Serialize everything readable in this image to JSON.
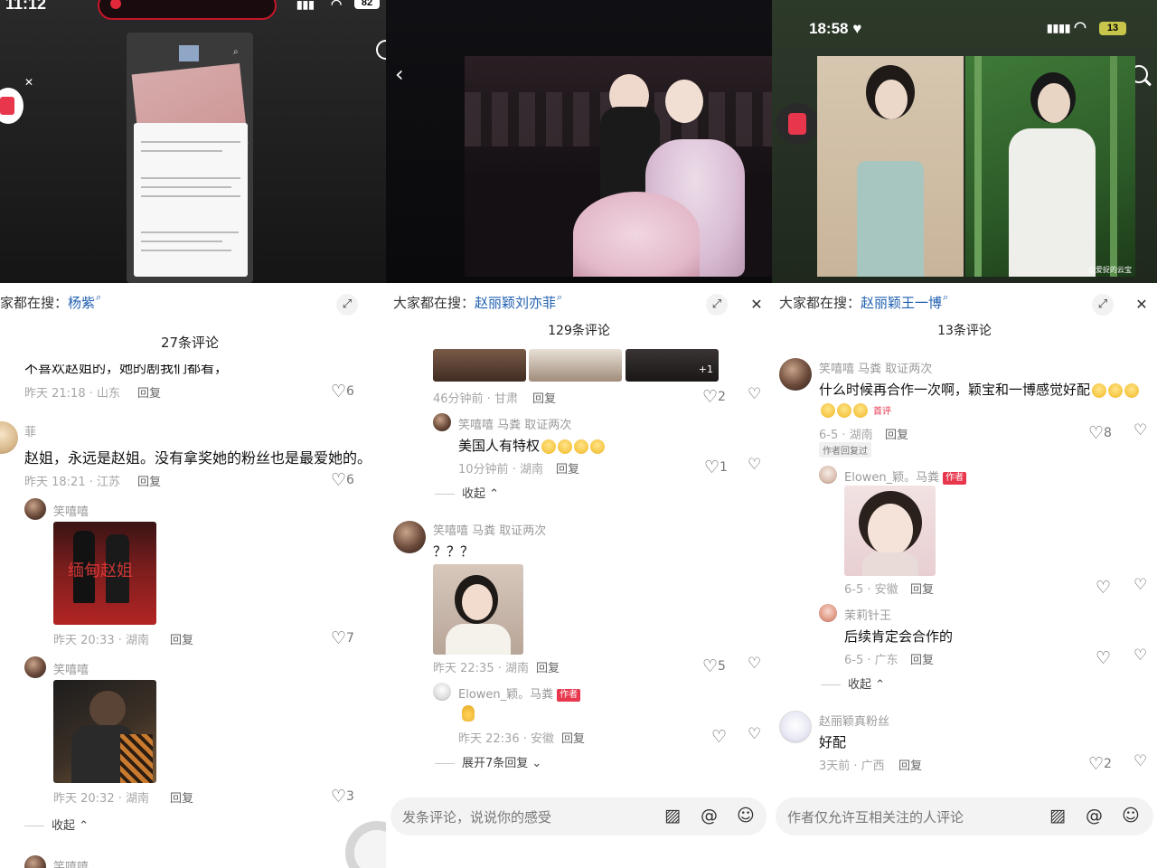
{
  "panel1": {
    "status_time": "11:12",
    "battery": "82",
    "search_prefix": "家都在搜：",
    "search_keyword": "杨紫",
    "comment_count": "27条评论",
    "comments": [
      {
        "text": "不喜欢赵姐的，她的剧我们都看，",
        "meta": "昨天 21:18 · 山东",
        "reply": "回复",
        "likes": "6"
      },
      {
        "user": "菲",
        "text": "赵姐，永远是赵姐。没有拿奖她的粉丝也是最爱她的。",
        "meta": "昨天 18:21 · 江苏",
        "reply": "回复",
        "likes": "6"
      },
      {
        "user": "笑嘻嘻",
        "image_caption": "缅甸赵姐",
        "meta": "昨天 20:33 · 湖南",
        "reply": "回复",
        "likes": "7"
      },
      {
        "user": "笑嘻嘻",
        "meta": "昨天 20:32 · 湖南",
        "reply": "回复",
        "likes": "3"
      },
      {
        "user": "笑嘻嘻"
      }
    ],
    "fold": "收起"
  },
  "panel2": {
    "search_prefix": "大家都在搜：",
    "search_keyword": "赵丽颖刘亦菲",
    "comment_count": "129条评论",
    "more_images_badge": "+1",
    "comments": [
      {
        "meta": "46分钟前 · 甘肃",
        "reply": "回复",
        "likes": "2"
      },
      {
        "user": "笑嘻嘻 马粪 取证两次",
        "text": "美国人有特权",
        "meta": "10分钟前 · 湖南",
        "reply": "回复",
        "likes": "1"
      },
      {
        "user": "笑嘻嘻 马粪 取证两次",
        "text": "？？？",
        "meta": "昨天 22:35 · 湖南",
        "reply": "回复",
        "likes": "5"
      },
      {
        "user": "Elowen_颖。马粪",
        "author_tag": "作者",
        "meta": "昨天 22:36 · 安徽",
        "reply": "回复"
      }
    ],
    "fold": "收起",
    "expand": "展开7条回复",
    "input_placeholder": "发条评论，说说你的感受"
  },
  "panel3": {
    "status_time": "18:58",
    "battery": "13",
    "search_prefix": "大家都在搜：",
    "search_keyword": "赵丽颖王一博",
    "comment_count": "13条评论",
    "watermark": "@爱捉的云宝",
    "comments": [
      {
        "user": "笑嘻嘻 马粪 取证两次",
        "text": "什么时候再合作一次啊，颖宝和一博感觉好配",
        "top_tag": "首评",
        "meta": "6-5 · 湖南",
        "reply": "回复",
        "likes": "8",
        "author_replied": "作者回复过"
      },
      {
        "user": "Elowen_颖。马粪",
        "author_tag": "作者",
        "meta": "6-5 · 安徽",
        "reply": "回复"
      },
      {
        "user": "茉莉针王",
        "text": "后续肯定会合作的",
        "meta": "6-5 · 广东",
        "reply": "回复"
      },
      {
        "user": "赵丽颖真粉丝",
        "text": "好配",
        "meta": "3天前 · 广西",
        "reply": "回复",
        "likes": "2"
      }
    ],
    "fold": "收起",
    "input_placeholder": "作者仅允许互相关注的人评论"
  },
  "colors": {
    "keyword_blue": "#1f5fb0",
    "author_red": "#e8364d"
  }
}
